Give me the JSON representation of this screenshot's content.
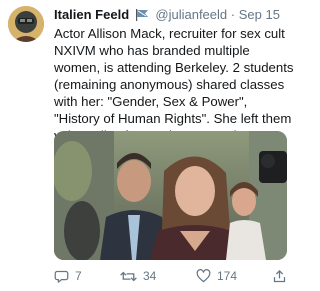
{
  "tweet": {
    "author_name": "Italien Feeld",
    "handle": "@julianfeeld",
    "separator": "·",
    "date": "Sep 15",
    "text": "Actor Allison Mack, recruiter for sex cult NXIVM who has branded multiple women, is attending Berkeley. 2 students (remaining anonymous) shared classes with her: \"Gender, Sex & Power\", \"History of Human Rights\". She left them voluntarily after student outcry but remains enrolled.",
    "replies": "7",
    "retweets": "34",
    "likes": "174"
  },
  "icons": {
    "reply": "comment-icon",
    "retweet": "retweet-icon",
    "like": "heart-icon",
    "share": "share-icon",
    "name_badge": "flag-emoji-icon"
  },
  "colors": {
    "text": "#14171a",
    "secondary_text": "#657786"
  }
}
